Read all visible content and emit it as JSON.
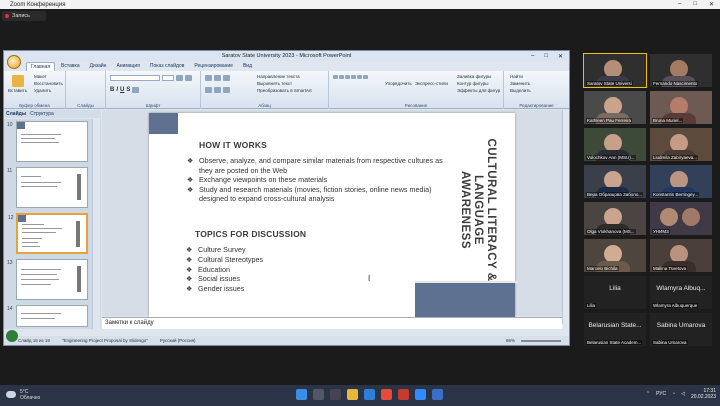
{
  "zoom": {
    "title": "Zoom Конференция",
    "rec": "Запись"
  },
  "ppt": {
    "title": "Saratov State University 2023 - Microsoft PowerPoint",
    "tabs": [
      "Главная",
      "Вставка",
      "Дизайн",
      "Анимация",
      "Показ слайдов",
      "Рецензирование",
      "Вид"
    ],
    "groups": {
      "clipboard": "Буфер обмена",
      "paste": "Вставить",
      "cut": "Макет",
      "copy": "Восстановить",
      "del": "Удалить",
      "slides": "Слайды",
      "font": "Шрифт",
      "paragraph": "Абзац",
      "text_dir": "Направление текста",
      "align_text": "Выровнять текст",
      "smartart": "Преобразовать в SmartArt",
      "drawing": "Рисование",
      "arrange": "Упорядочить",
      "quick_styles": "Экспресс-стили",
      "fill": "Заливка фигуры",
      "outline": "Контур фигуры",
      "effects": "Эффекты для фигур",
      "editing": "Редактирование",
      "find": "Найти",
      "replace": "Заменить",
      "select": "Выделить"
    },
    "panel_tabs": [
      "Слайды",
      "Структура"
    ],
    "thumb_numbers": [
      "10",
      "11",
      "12",
      "13",
      "14"
    ],
    "slide": {
      "how_title": "HOW IT WORKS",
      "how_items": [
        "Observe, analyze, and compare similar materials from respective cultures as they are posted on the Web",
        "Exchange viewpoints on these materials",
        "Study and research materials (movies, fiction stories, online news media) designed to expand cross-cultural analysis"
      ],
      "topics_title": "TOPICS FOR DISCUSSION",
      "topics": [
        "Culture Survey",
        "Cultural Stereotypes",
        "Education",
        "Social issues",
        "Gender issues"
      ],
      "side_title": "CULTURAL LITERACY & LANGUAGE AWARENESS",
      "bullet_how": "❖",
      "bullet_topic": "❖"
    },
    "notes": "Заметки к слайду",
    "status": {
      "slide": "Слайд 16 из 19",
      "theme": "\"Engineering Project Proposal by Slidesgo\"",
      "lang": "Русский (Россия)",
      "zoom": "86%"
    }
  },
  "gallery": [
    {
      "name": "Saratov State Universi"
    },
    {
      "name": "Fernando Nascimento"
    },
    {
      "name": "Kathleen Pau Ferreira"
    },
    {
      "name": "Bruna Muriel..."
    },
    {
      "name": "Volochkov Ann (MSU)..."
    },
    {
      "name": "Liudmila Zabiryaeva..."
    },
    {
      "name": "Вера Образцова Заболо..."
    },
    {
      "name": "Konstantin Berringey..."
    },
    {
      "name": "Olga Vlokhanova (MS..."
    },
    {
      "name": "УНИМЗ"
    },
    {
      "name": "Marcelo Bichila"
    },
    {
      "name": "Mallina Tsvetova"
    }
  ],
  "gallery_blank": [
    {
      "big": "Lilia",
      "small": "Lilia"
    },
    {
      "big": "Wlamyra Albuq...",
      "small": "Wlamyra Albuquerque"
    },
    {
      "big": "Belarusian State...",
      "small": "Belarusian State Academ..."
    },
    {
      "big": "Sabina Umarova",
      "small": "Sabina Umarova"
    }
  ],
  "taskbar": {
    "temp": "5°C",
    "weather": "Облачно",
    "lang": "РУС",
    "time": "17:31",
    "date": "20.02.2023"
  },
  "colors": {
    "accent_square": "#5e7190",
    "ribbon": "#dbe5f1",
    "taskbar": "#2a3446"
  }
}
